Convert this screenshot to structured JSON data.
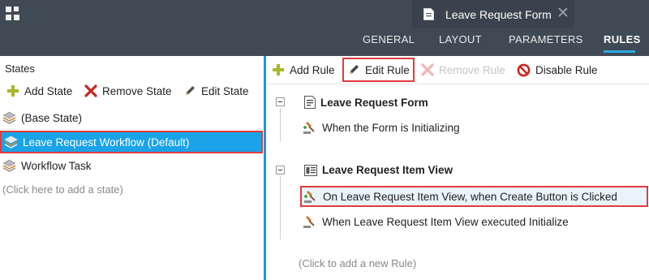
{
  "header": {
    "document_tab": {
      "title": "Leave Request Form",
      "icon": "form-icon",
      "close_icon": "close-icon"
    },
    "nav_tabs": [
      {
        "label": "GENERAL",
        "active": false
      },
      {
        "label": "LAYOUT",
        "active": false
      },
      {
        "label": "PARAMETERS",
        "active": false
      },
      {
        "label": "RULES",
        "active": true
      }
    ],
    "colors": {
      "header_bg": "#3f4a55",
      "accent": "#2aa8e0"
    }
  },
  "states_panel": {
    "title": "States",
    "toolbar": {
      "add_label": "Add State",
      "remove_label": "Remove State",
      "edit_label": "Edit State"
    },
    "items": [
      {
        "label": "(Base State)",
        "selected": false
      },
      {
        "label": "Leave Request Workflow (Default)",
        "selected": true
      },
      {
        "label": "Workflow Task",
        "selected": false
      }
    ],
    "add_hint": "(Click here to add a state)"
  },
  "rules_panel": {
    "toolbar": {
      "add_label": "Add Rule",
      "edit_label": "Edit Rule",
      "remove_label": "Remove Rule",
      "disable_label": "Disable Rule"
    },
    "groups": [
      {
        "title": "Leave Request Form",
        "icon": "form-icon",
        "rules": [
          {
            "label": "When the Form is Initializing",
            "selected": false
          }
        ]
      },
      {
        "title": "Leave Request Item View",
        "icon": "view-icon",
        "rules": [
          {
            "label": "On Leave Request Item View, when Create Button is Clicked",
            "selected": true
          },
          {
            "label": "When Leave Request Item View executed Initialize",
            "selected": false
          }
        ]
      }
    ],
    "add_hint": "(Click to add a new Rule)"
  }
}
